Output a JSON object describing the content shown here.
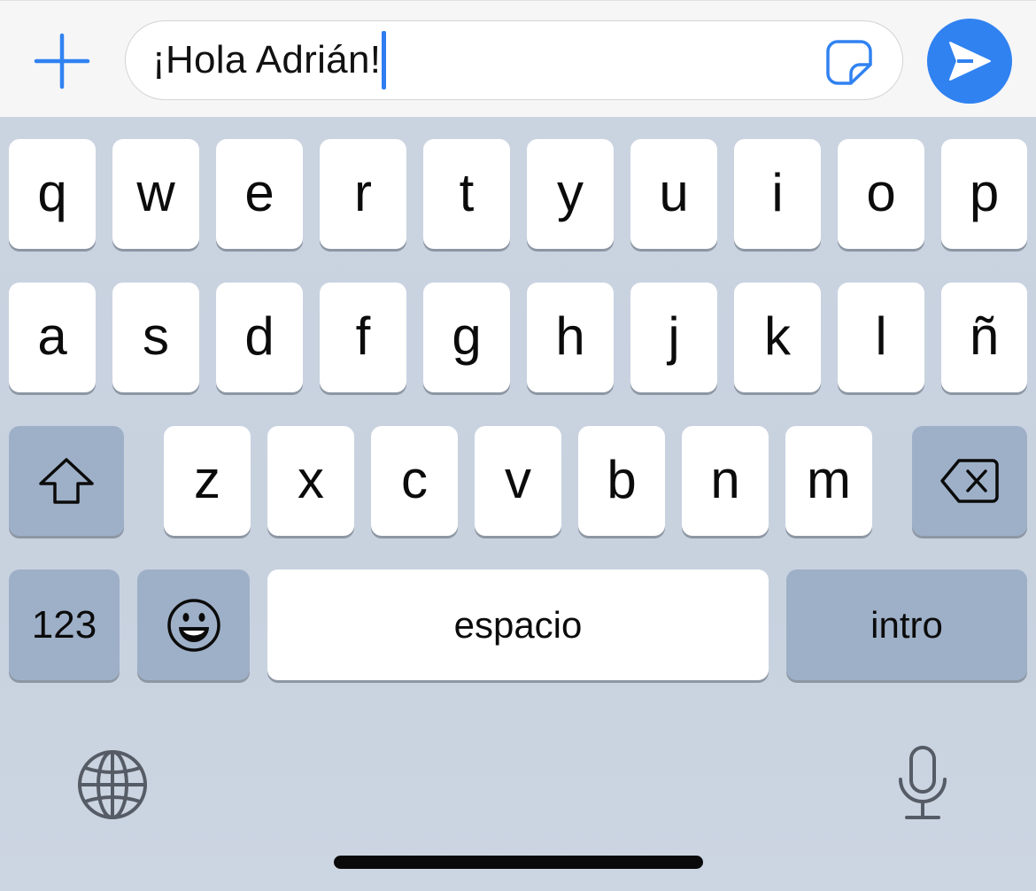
{
  "compose": {
    "message_text": "¡Hola Adrián!",
    "accent_color": "#3082f1"
  },
  "keyboard": {
    "row1": [
      "q",
      "w",
      "e",
      "r",
      "t",
      "y",
      "u",
      "i",
      "o",
      "p"
    ],
    "row2": [
      "a",
      "s",
      "d",
      "f",
      "g",
      "h",
      "j",
      "k",
      "l",
      "ñ"
    ],
    "row3": [
      "z",
      "x",
      "c",
      "v",
      "b",
      "n",
      "m"
    ],
    "numbers_label": "123",
    "space_label": "espacio",
    "return_label": "intro",
    "key_color": "#ffffff",
    "function_key_color": "#9eb0c8"
  },
  "icons": {
    "plus": "plus-icon",
    "sticker": "sticker-icon",
    "send": "send-icon",
    "shift": "shift-icon",
    "delete": "delete-icon",
    "emoji": "emoji-icon",
    "globe": "globe-icon",
    "microphone": "microphone-icon"
  }
}
